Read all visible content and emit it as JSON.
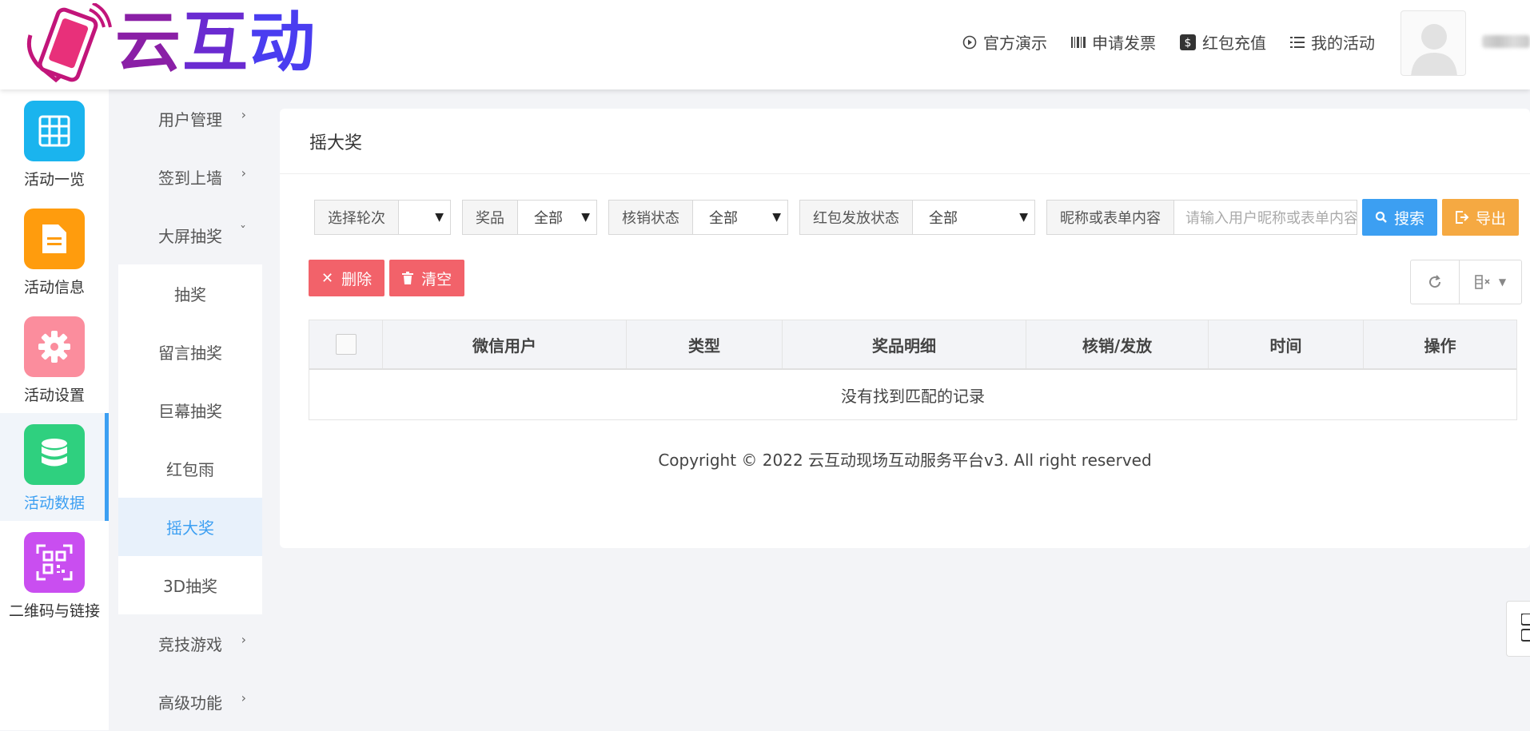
{
  "header": {
    "logo_text": [
      "云",
      "互",
      "动"
    ],
    "nav": [
      {
        "label": "官方演示",
        "icon": "play-circle-icon"
      },
      {
        "label": "申请发票",
        "icon": "barcode-icon"
      },
      {
        "label": "红包充值",
        "icon": "dollar-icon"
      },
      {
        "label": "我的活动",
        "icon": "list-icon"
      }
    ]
  },
  "rail": [
    {
      "label": "活动一览",
      "icon": "grid-icon",
      "color": "#1ab4ee"
    },
    {
      "label": "活动信息",
      "icon": "document-icon",
      "color": "#ff9c0d"
    },
    {
      "label": "活动设置",
      "icon": "gear-icon",
      "color": "#fb8d9d"
    },
    {
      "label": "活动数据",
      "icon": "database-icon",
      "color": "#2fd07f",
      "active": true
    },
    {
      "label": "二维码与链接",
      "icon": "qrcode-icon",
      "color": "#c94ef0"
    }
  ],
  "subnav": {
    "groups": [
      {
        "label": "用户管理",
        "arrow": "›"
      },
      {
        "label": "签到上墙",
        "arrow": "›"
      },
      {
        "label": "大屏抽奖",
        "arrow": "ˇ"
      }
    ],
    "children": [
      "抽奖",
      "留言抽奖",
      "巨幕抽奖",
      "红包雨",
      "摇大奖",
      "3D抽奖"
    ],
    "active_child": "摇大奖",
    "groups_after": [
      {
        "label": "竞技游戏",
        "arrow": "›"
      },
      {
        "label": "高级功能",
        "arrow": "›"
      }
    ]
  },
  "main": {
    "title": "摇大奖",
    "filters": {
      "round_label": "选择轮次",
      "round_value": "",
      "prize_label": "奖品",
      "prize_value": "全部",
      "verify_label": "核销状态",
      "verify_value": "全部",
      "redpack_label": "红包发放状态",
      "redpack_value": "全部",
      "keyword_label": "昵称或表单内容",
      "keyword_placeholder": "请输入用户昵称或表单内容"
    },
    "buttons": {
      "search": "搜索",
      "export": "导出",
      "delete": "删除",
      "clear": "清空"
    },
    "table": {
      "columns": [
        "微信用户",
        "类型",
        "奖品明细",
        "核销/发放",
        "时间",
        "操作"
      ],
      "empty_text": "没有找到匹配的记录"
    },
    "copyright": "Copyright © 2022 云互动现场互动服务平台v3. All right reserved"
  },
  "colors": {
    "primary": "#3c9ff2",
    "warning": "#f5a942",
    "danger": "#f2626a"
  }
}
